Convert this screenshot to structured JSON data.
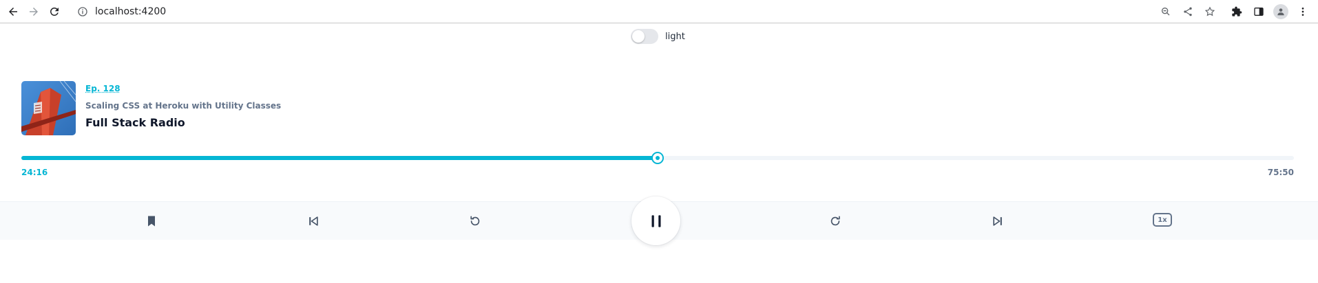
{
  "browser": {
    "url": "localhost:4200"
  },
  "theme_toggle": {
    "label": "light",
    "enabled": false
  },
  "episode": {
    "number_label": "Ep. 128",
    "title": "Scaling CSS at Heroku with Utility Classes",
    "show": "Full Stack Radio",
    "cover_icon": "golden-gate-bridge-photo"
  },
  "progress": {
    "current_time": "24:16",
    "total_time": "75:50",
    "fraction": 0.5,
    "accent_color": "#06b6d4",
    "track_color": "#f1f5f9"
  },
  "controls": {
    "bookmark_icon": "bookmark-icon",
    "previous_icon": "skip-previous-icon",
    "rewind_icon": "rewind-icon",
    "play_state_icon": "pause-icon",
    "forward_icon": "fast-forward-icon",
    "next_icon": "skip-next-icon",
    "speed_label": "1x"
  }
}
